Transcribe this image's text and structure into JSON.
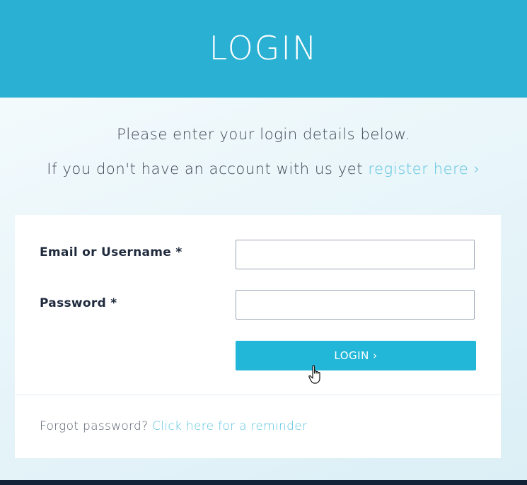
{
  "header": {
    "title": "LOGIN"
  },
  "intro": {
    "line1": "Please enter your login details below.",
    "line2_prefix": "If you don't have an account with us yet ",
    "register_link": "register here ›"
  },
  "form": {
    "email_label": "Email or Username *",
    "email_value": "",
    "password_label": "Password *",
    "password_value": "",
    "login_button": "LOGIN ›"
  },
  "forgot": {
    "prefix": "Forgot password? ",
    "link": "Click here for a reminder"
  },
  "colors": {
    "header_bg": "#29b0d3",
    "button_bg": "#22b7d9",
    "link": "#5cc3df",
    "footer_bar": "#142238"
  }
}
